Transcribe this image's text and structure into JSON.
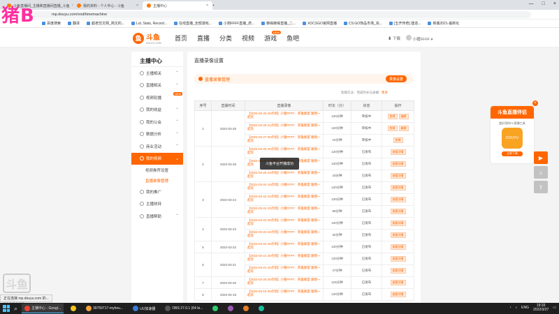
{
  "browser": {
    "tabs": [
      {
        "label": "斗鱼直播间_主播和直播间直播_斗鱼",
        "active": false
      },
      {
        "label": "我的资料 - 个人中心 - 斗鱼",
        "active": false
      },
      {
        "label": "主播中心",
        "active": true
      }
    ],
    "url": "mp.douyu.com/vod/timemachine",
    "bookmarks": [
      "百度搜索",
      "翻译",
      "超老仿文网_简文的...",
      "LoL Stats, Record...",
      "在线直播_全部游戏...",
      "小狗FFFF直播_虎...",
      "御缘御缘直播_二...",
      "XOCSGO官网直播",
      "CS:GO饰品市场_完...",
      "[五开传奇] 建造...",
      "新版2021-最新化"
    ]
  },
  "overlay": {
    "brand": "猪B",
    "id": "6102065"
  },
  "site": {
    "logo_text": "斗鱼",
    "logo_sub": "DOUYU.COM",
    "nav": [
      "首页",
      "直播",
      "分类",
      "视频",
      "游戏",
      "鱼吧"
    ],
    "nav_badge": "NEW",
    "download": "下载",
    "username": "小猪FFFF"
  },
  "sidebar": {
    "title": "主播中心",
    "items": [
      {
        "label": "主播相关"
      },
      {
        "label": "直播相关"
      },
      {
        "label": "视频轮播",
        "badge": "NEW"
      },
      {
        "label": "我的收益"
      },
      {
        "label": "我的公会"
      },
      {
        "label": "数据分析"
      },
      {
        "label": "商业活动"
      },
      {
        "label": "我的视频"
      },
      {
        "label": "视频推荐设置"
      },
      {
        "label": "直播录像管理"
      },
      {
        "label": "我的推广"
      },
      {
        "label": "主播扶持"
      },
      {
        "label": "直播帮助"
      }
    ]
  },
  "main": {
    "title": "直播录像设置",
    "section_label": "直播录像管理",
    "settings_button": "录像设置",
    "note": "剪辑方法：完成时长与录播",
    "note_more": "更多",
    "table_headers": [
      "序号",
      "直播时间",
      "直播录像",
      "时长（分）",
      "状态",
      "操作"
    ],
    "groups": [
      {
        "no": "1",
        "date": "2022-03-26",
        "rows": [
          {
            "title": "【2022-03-26 20点场】小猪FFFF：英雄联盟 跟我一起玩",
            "duration": "120分钟",
            "status": "审核中",
            "ops": [
              "剪辑",
              "编辑"
            ]
          },
          {
            "title": "【2022-03-26 21点场】小猪FFFF：英雄联盟 跟我一起玩",
            "duration": "120分钟",
            "status": "审核中",
            "ops": [
              "剪辑",
              "编辑"
            ]
          },
          {
            "title": "【2022-03-27 00点场】小猪FFFF：英雄联盟 跟我一起玩",
            "duration": "10分钟",
            "status": "审核中",
            "ops": [
              "剪辑"
            ]
          }
        ]
      },
      {
        "no": "2",
        "date": "2022-03-25",
        "rows": [
          {
            "title": "【2022-03-25 20点场】小猪FFFF：英雄联盟 跟我一起玩",
            "duration": "120分钟",
            "status": "已发布",
            "ops": [
              "查看详情"
            ]
          },
          {
            "title": "【2022-03-25 21点场】小猪FFFF：英雄联盟 跟我一起玩",
            "duration": "120分钟",
            "status": "已发布",
            "ops": [
              "查看详情"
            ]
          },
          {
            "title": "【2022-03-25 23点场】小猪FFFF：英雄联盟 跟我一起玩",
            "duration": "43分钟",
            "status": "已发布",
            "ops": [
              "查看详情"
            ]
          }
        ]
      },
      {
        "no": "3",
        "date": "2022-03-24",
        "rows": [
          {
            "title": "【2022-03-24 19点场】小猪FFFF：英雄联盟 跟我一起玩",
            "duration": "120分钟",
            "status": "已发布",
            "ops": [
              "查看详情"
            ]
          },
          {
            "title": "【2022-03-24 21点场】小猪FFFF：英雄联盟 跟我一起玩",
            "duration": "120分钟",
            "status": "已发布",
            "ops": [
              "查看详情"
            ]
          },
          {
            "title": "【2022-03-24 23点场】小猪FFFF：英雄联盟 跟我一起玩",
            "duration": "59分钟",
            "status": "已发布",
            "ops": [
              "查看详情"
            ]
          }
        ]
      },
      {
        "no": "4",
        "date": "2022-03-23",
        "rows": [
          {
            "title": "【2022-03-23 20点场】小猪FFFF：英雄联盟 跟我一起玩",
            "duration": "120分钟",
            "status": "已发布",
            "ops": [
              "查看详情"
            ]
          },
          {
            "title": "【2022-03-23 22点场】小猪FFFF：英雄联盟 跟我一起玩",
            "duration": "32分钟",
            "status": "已发布",
            "ops": [
              "查看详情"
            ]
          }
        ]
      },
      {
        "no": "5",
        "date": "2022-03-22",
        "rows": [
          {
            "title": "【2022-03-22 20点场】小猪FFFF：英雄联盟 跟我一起玩",
            "duration": "120分钟",
            "status": "已发布",
            "ops": [
              "查看详情"
            ]
          }
        ]
      },
      {
        "no": "6",
        "date": "2022-03-21",
        "rows": [
          {
            "title": "【2022-03-21 20点场】小猪FFFF：英雄联盟 跟我一起玩",
            "duration": "120分钟",
            "status": "已发布",
            "ops": [
              "查看详情"
            ]
          },
          {
            "title": "【2022-03-21 22点场】小猪FFFF：英雄联盟 跟我一起玩",
            "duration": "47分钟",
            "status": "已发布",
            "ops": [
              "查看详情"
            ]
          }
        ]
      },
      {
        "no": "7",
        "date": "2022-03-20",
        "rows": [
          {
            "title": "【2022-03-20 20点场】小猪FFFF：英雄联盟 跟我一起玩",
            "duration": "116分钟",
            "status": "已发布",
            "ops": [
              "查看详情"
            ]
          }
        ]
      },
      {
        "no": "8",
        "date": "2022-03-19",
        "rows": [
          {
            "title": "【2022-03-19 20点场】小猪FFFF：英雄联盟 跟我一起玩",
            "duration": "120分钟",
            "status": "已发布",
            "ops": [
              "查看详情"
            ]
          }
        ]
      }
    ],
    "toast": "斗鱼平台开播成功"
  },
  "promo": {
    "title": "斗鱼直播伴侣",
    "subtitle": "超好用的PC直播工具",
    "image_label": "DOUYU",
    "button": "立即下载",
    "close": "×"
  },
  "statusbar": "正在连接 mp.douyu.com 的...",
  "taskbar": {
    "apps": [
      "主播中心 - Googl...",
      "",
      "39759717-myhou...",
      "UU加速器",
      "OBS 27.0.1 (64 bi...",
      "",
      "",
      "",
      "",
      "",
      ""
    ],
    "lang": "ENG",
    "time": "19:33",
    "date": "2022/3/27"
  },
  "colors": {
    "accent": "#ff6600",
    "overlay_pink": "#ff2fa0"
  }
}
